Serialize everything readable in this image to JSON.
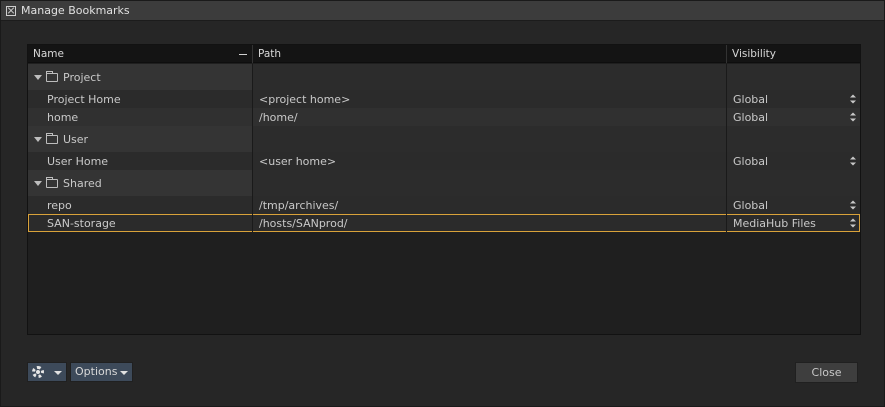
{
  "window": {
    "title": "Manage Bookmarks"
  },
  "table": {
    "columns": {
      "name": "Name",
      "path": "Path",
      "visibility": "Visibility"
    },
    "rows": [
      {
        "type": "group",
        "name": "Project"
      },
      {
        "type": "item",
        "name": "Project Home",
        "path": "<project home>",
        "visibility": "Global"
      },
      {
        "type": "item",
        "name": "home",
        "path": "/home/",
        "visibility": "Global"
      },
      {
        "type": "group",
        "name": "User"
      },
      {
        "type": "item",
        "name": "User Home",
        "path": "<user home>",
        "visibility": "Global"
      },
      {
        "type": "group",
        "name": "Shared"
      },
      {
        "type": "item",
        "name": "repo",
        "path": "/tmp/archives/",
        "visibility": "Global"
      },
      {
        "type": "item",
        "name": "SAN-storage",
        "path": "/hosts/SANprod/",
        "visibility": "MediaHub Files",
        "selected": true
      }
    ]
  },
  "footer": {
    "gear_icon": "gear-icon",
    "options_label": "Options",
    "close_label": "Close"
  },
  "colors": {
    "selection_outline": "#d9a23a",
    "button_blue": "#3d4a5a"
  }
}
